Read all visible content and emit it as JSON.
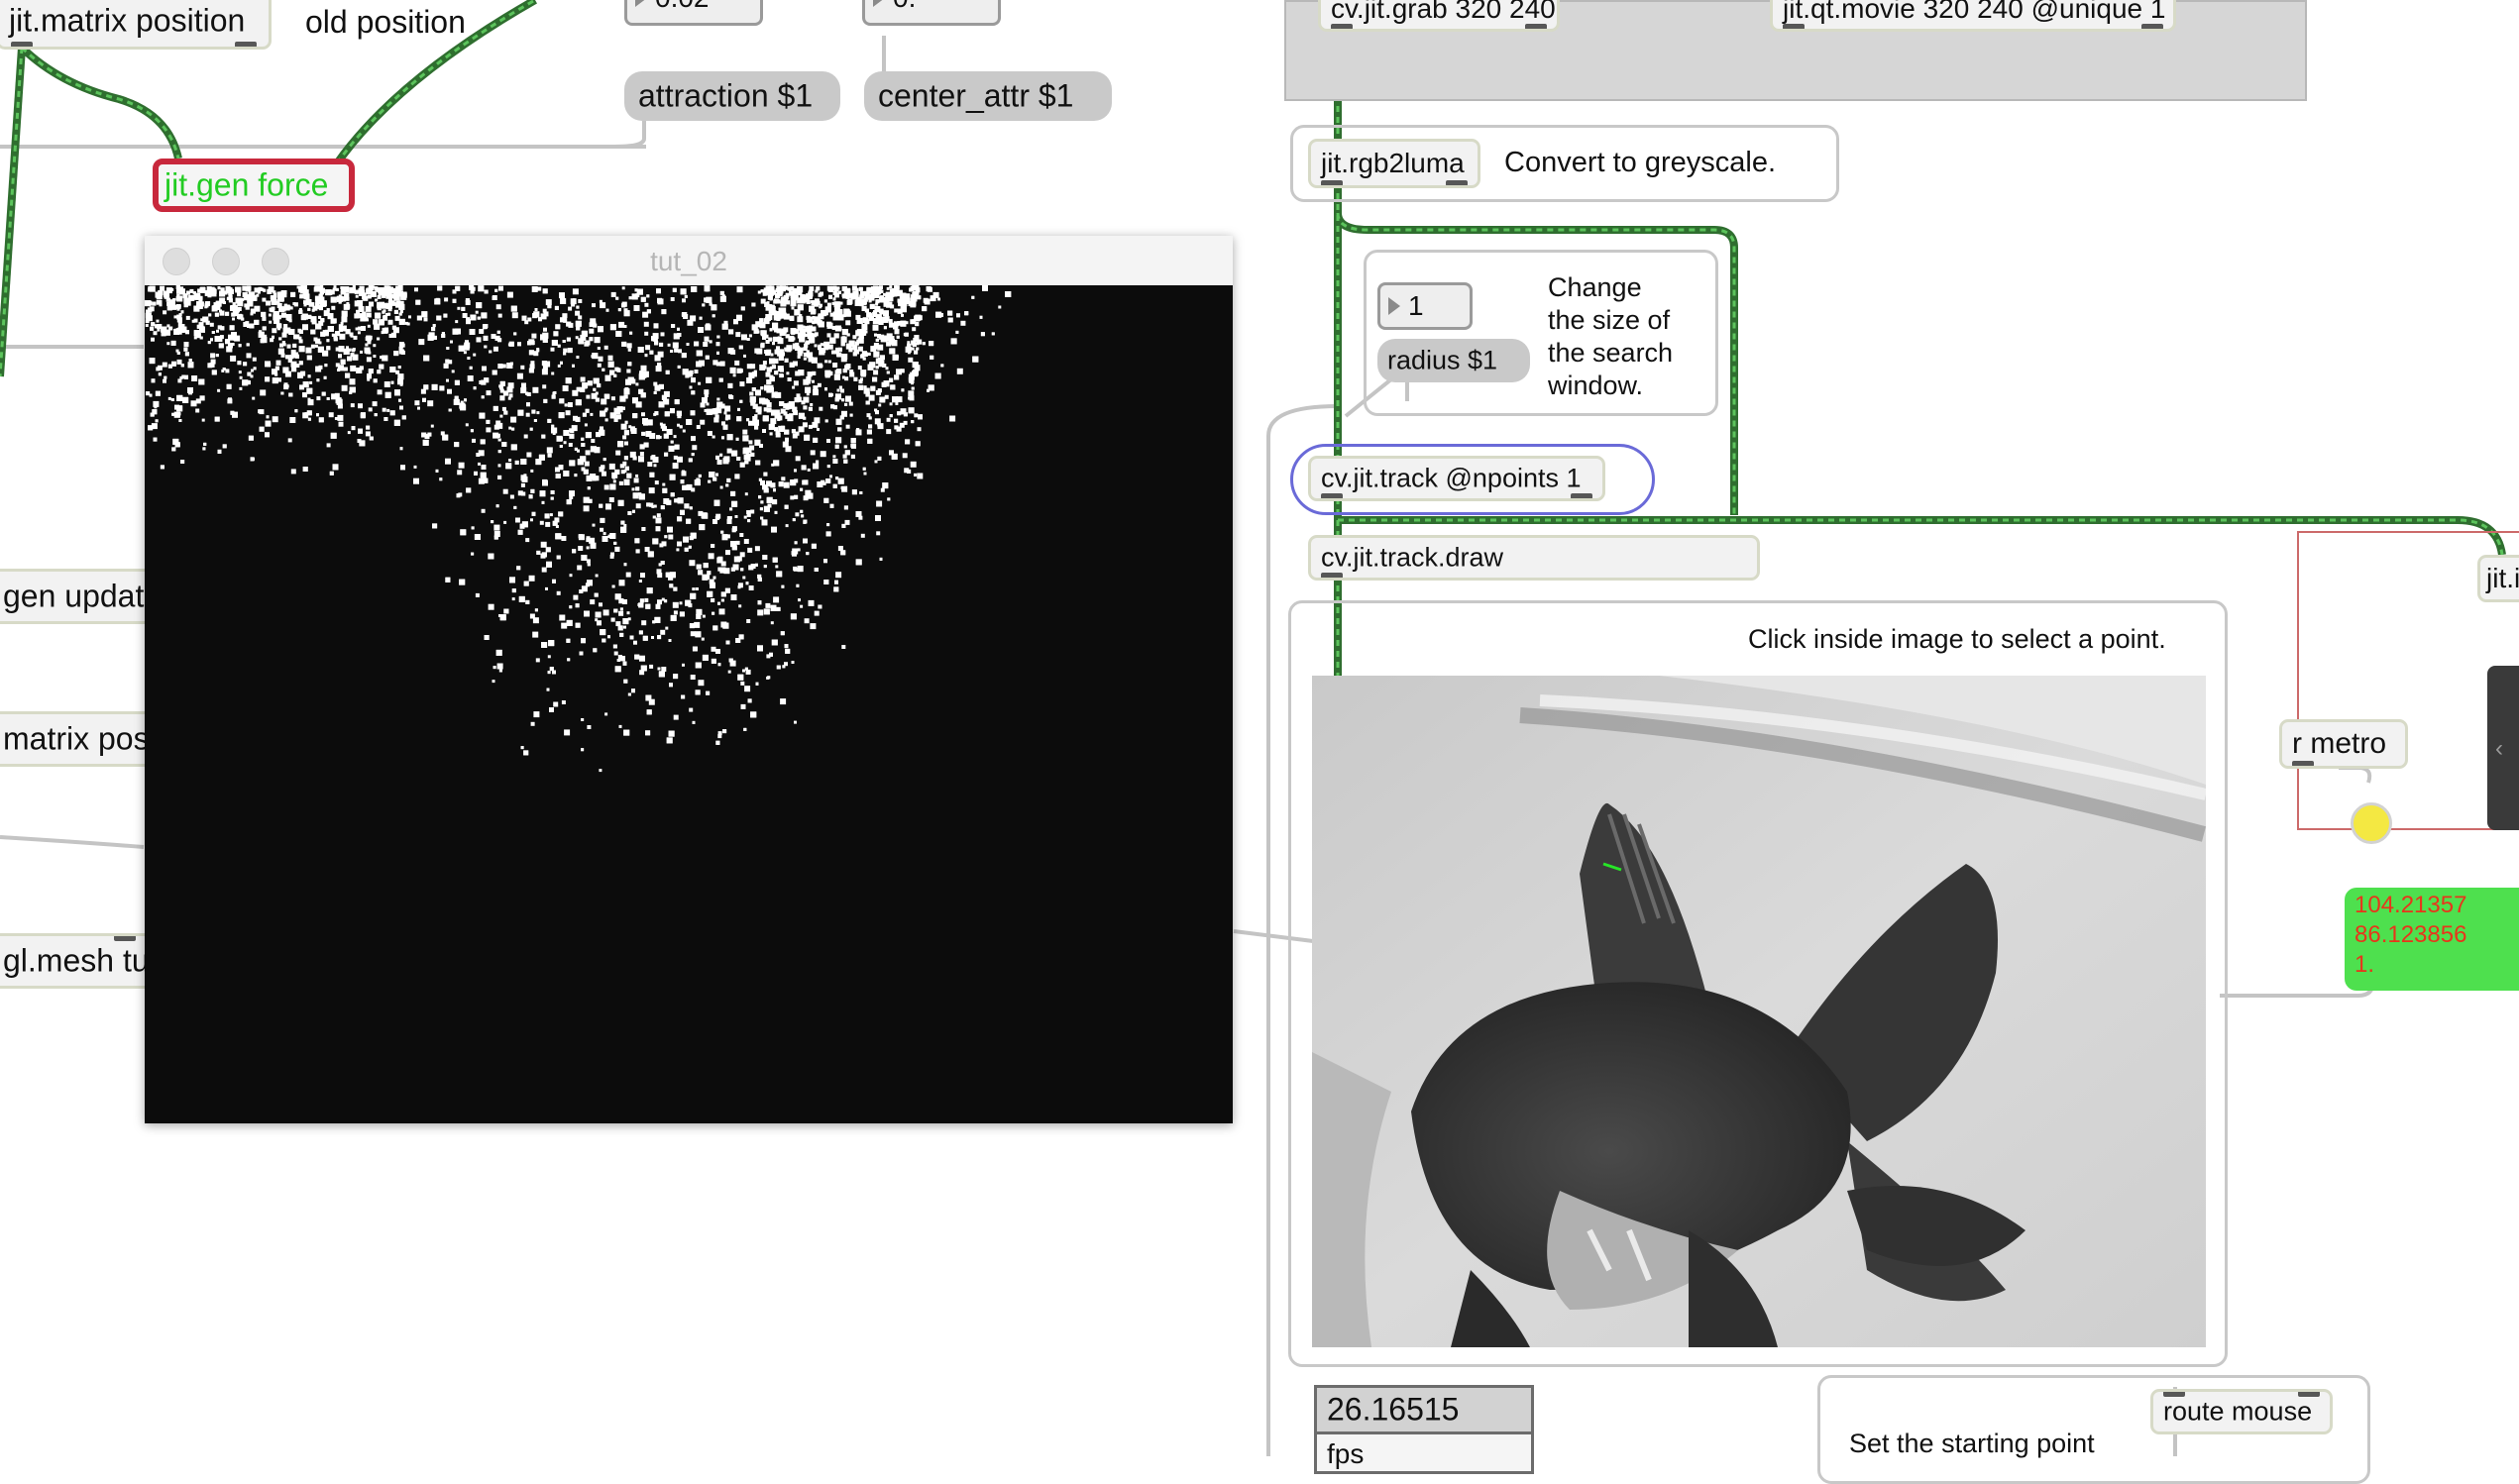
{
  "objects": {
    "jit_matrix_position": "jit.matrix position",
    "jit_gen_force": "jit.gen force",
    "cv_jit_grab": "cv.jit.grab 320 240",
    "jit_qt_movie": "jit.qt.movie 320 240 @unique 1",
    "jit_rgb2luma": "jit.rgb2luma",
    "cv_jit_track": "cv.jit.track @npoints 1",
    "cv_jit_track_draw": "cv.jit.track.draw",
    "gen_update": "gen updat",
    "matrix_pos": "matrix pos",
    "gl_mesh": "gl.mesh tu",
    "r_metro": "r metro",
    "jit_right": "jit.i",
    "route_mouse": "route mouse"
  },
  "messages": {
    "attraction": "attraction $1",
    "center_attr": "center_attr $1",
    "radius": "radius $1"
  },
  "numbers": {
    "attraction_value": "0.02",
    "center_value": "0.",
    "radius_value": "1"
  },
  "comments": {
    "old_position": "old position",
    "convert_greyscale": "Convert to greyscale.",
    "change_size": [
      "Change",
      "the size of",
      "the search",
      "window."
    ],
    "click_inside": "Click inside image to select a point.",
    "set_starting_point": "Set the starting point"
  },
  "window": {
    "title": "tut_02"
  },
  "display": {
    "fps_value": "26.16515",
    "fps_label": "fps",
    "coords": [
      "104.21357",
      "86.123856",
      "1."
    ]
  },
  "colors": {
    "patch_cord_green": "#4fa84f",
    "gen_border": "#c8283c",
    "gen_text": "#22cc22",
    "track_border": "#6a6ad8",
    "bang": "#f4e842",
    "coord_bg": "#4ee04e",
    "coord_text": "#e8351b"
  }
}
